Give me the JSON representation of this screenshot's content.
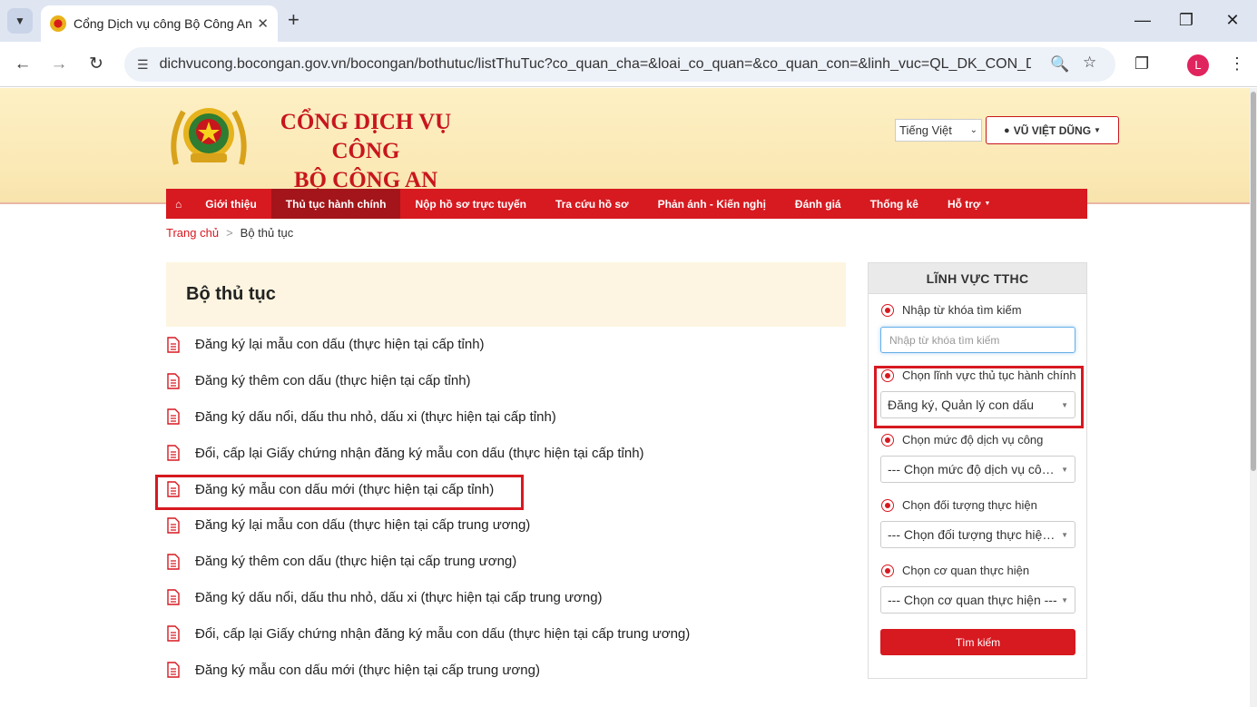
{
  "browser": {
    "tab_title": "Cổng Dịch vụ công Bộ Công An",
    "url": "dichvucong.bocongan.gov.vn/bocongan/bothutuc/listThuTuc?co_quan_cha=&loai_co_quan=&co_quan_con=&linh_vuc=QL_DK_CON_DA...",
    "profile_initial": "L"
  },
  "header": {
    "site_title_line1": "CỔNG DỊCH VỤ CÔNG",
    "site_title_line2": "BỘ CÔNG AN",
    "language": "Tiếng Việt",
    "user_name": "VŨ VIỆT DŨNG"
  },
  "nav": {
    "items": [
      {
        "label": "Giới thiệu"
      },
      {
        "label": "Thủ tục hành chính"
      },
      {
        "label": "Nộp hồ sơ trực tuyến"
      },
      {
        "label": "Tra cứu hồ sơ"
      },
      {
        "label": "Phản ánh - Kiến nghị"
      },
      {
        "label": "Đánh giá"
      },
      {
        "label": "Thống kê"
      },
      {
        "label": "Hỗ trợ"
      }
    ],
    "active_index": 1
  },
  "breadcrumb": {
    "home": "Trang chủ",
    "current": "Bộ thủ tục"
  },
  "content": {
    "title": "Bộ thủ tục",
    "procedures": [
      "Đăng ký lại mẫu con dấu (thực hiện tại cấp tỉnh)",
      "Đăng ký thêm con dấu (thực hiện tại cấp tỉnh)",
      "Đăng ký dấu nổi, dấu thu nhỏ, dấu xi (thực hiện tại cấp tỉnh)",
      "Đổi, cấp lại Giấy chứng nhận đăng ký mẫu con dấu (thực hiện tại cấp tỉnh)",
      "Đăng ký mẫu con dấu mới (thực hiện tại cấp tỉnh)",
      "Đăng ký lại mẫu con dấu (thực hiện tại cấp trung ương)",
      "Đăng ký thêm con dấu (thực hiện tại cấp trung ương)",
      "Đăng ký dấu nổi, dấu thu nhỏ, dấu xi (thực hiện tại cấp trung ương)",
      "Đổi, cấp lại Giấy chứng nhận đăng ký mẫu con dấu (thực hiện tại cấp trung ương)",
      "Đăng ký mẫu con dấu mới (thực hiện tại cấp trung ương)"
    ],
    "highlighted_index": 4
  },
  "sidebar": {
    "title": "LĨNH VỰC TTHC",
    "keyword_label": "Nhập từ khóa tìm kiếm",
    "keyword_placeholder": "Nhập từ khóa tìm kiếm",
    "field_label": "Chọn lĩnh vực thủ tục hành chính",
    "field_value": "Đăng ký, Quản lý con dấu",
    "level_label": "Chọn mức độ dịch vụ công",
    "level_value": "--- Chọn mức độ dịch vụ công ---",
    "target_label": "Chọn đối tượng thực hiện",
    "target_value": "--- Chọn đối tượng thực hiện ---",
    "agency_label": "Chọn cơ quan thực hiện",
    "agency_value": "--- Chọn cơ quan thực hiện ---",
    "search_button": "Tìm kiếm"
  },
  "colors": {
    "brand_red": "#d71920",
    "header_bg": "#fbe9b6",
    "nav_active": "#a3151a"
  }
}
